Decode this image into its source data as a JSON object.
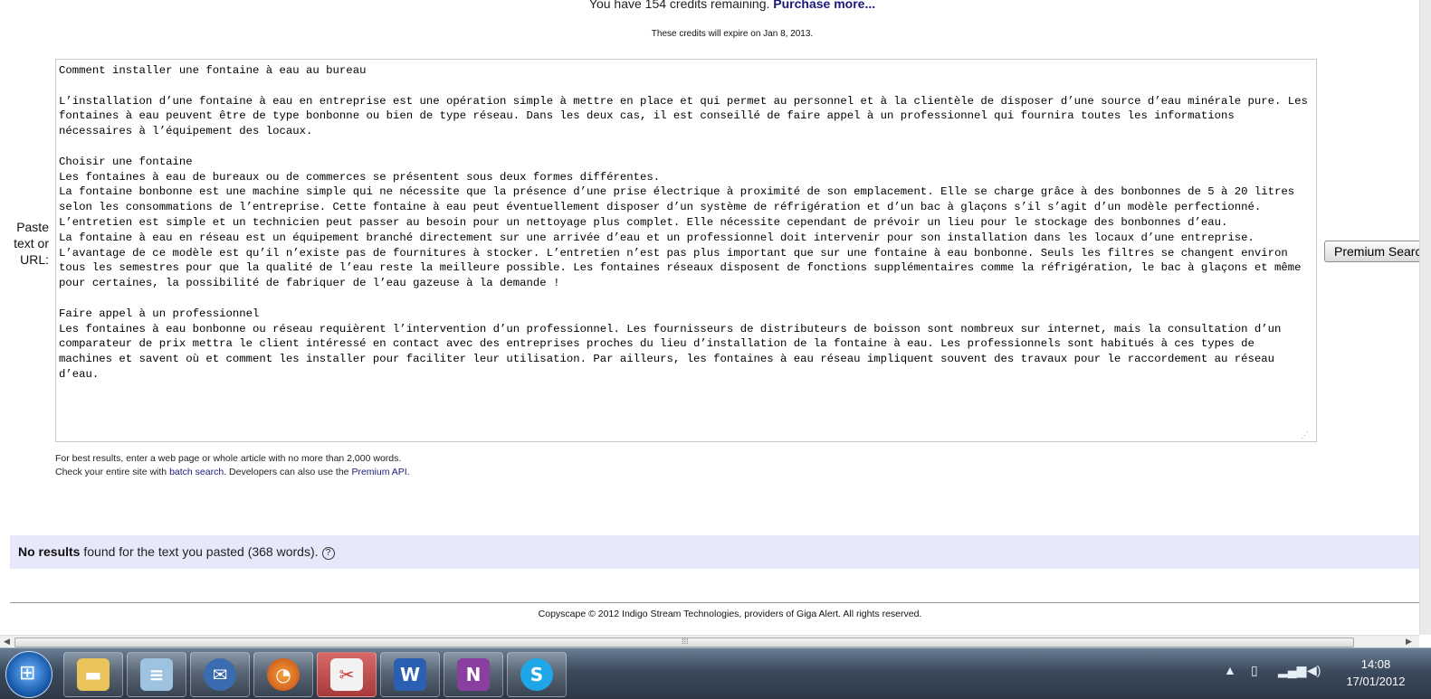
{
  "header": {
    "credits_text": "You have 154 credits remaining.",
    "purchase_link": "Purchase more...",
    "expire_text": "These credits will expire on Jan 8, 2013."
  },
  "form": {
    "paste_label": "Paste text or URL:",
    "text_value": "Comment installer une fontaine à eau au bureau\n\nL’installation d’une fontaine à eau en entreprise est une opération simple à mettre en place et qui permet au personnel et à la clientèle de disposer d’une source d’eau minérale pure. Les fontaines à eau peuvent être de type bonbonne ou bien de type réseau. Dans les deux cas, il est conseillé de faire appel à un professionnel qui fournira toutes les informations nécessaires à l’équipement des locaux.\n\nChoisir une fontaine\nLes fontaines à eau de bureaux ou de commerces se présentent sous deux formes différentes.\nLa fontaine bonbonne est une machine simple qui ne nécessite que la présence d’une prise électrique à proximité de son emplacement. Elle se charge grâce à des bonbonnes de 5 à 20 litres selon les consommations de l’entreprise. Cette fontaine à eau peut éventuellement disposer d’un système de réfrigération et d’un bac à glaçons s’il s’agit d’un modèle perfectionné. L’entretien est simple et un technicien peut passer au besoin pour un nettoyage plus complet. Elle nécessite cependant de prévoir un lieu pour le stockage des bonbonnes d’eau.\nLa fontaine à eau en réseau est un équipement branché directement sur une arrivée d’eau et un professionnel doit intervenir pour son installation dans les locaux d’une entreprise. L’avantage de ce modèle est qu’il n’existe pas de fournitures à stocker. L’entretien n’est pas plus important que sur une fontaine à eau bonbonne. Seuls les filtres se changent environ tous les semestres pour que la qualité de l’eau reste la meilleure possible. Les fontaines réseaux disposent de fonctions supplémentaires comme la réfrigération, le bac à glaçons et même pour certaines, la possibilité de fabriquer de l’eau gazeuse à la demande !\n\nFaire appel à un professionnel\nLes fontaines à eau bonbonne ou réseau requièrent l’intervention d’un professionnel. Les fournisseurs de distributeurs de boisson sont nombreux sur internet, mais la consultation d’un comparateur de prix mettra le client intéressé en contact avec des entreprises proches du lieu d’installation de la fontaine à eau. Les professionnels sont habitués à ces types de machines et savent où et comment les installer pour faciliter leur utilisation. Par ailleurs, les fontaines à eau réseau impliquent souvent des travaux pour le raccordement au réseau d’eau.",
    "search_button": "Premium Search",
    "hint_line1": "For best results, enter a web page or whole article with no more than 2,000 words.",
    "hint_line2_a": "Check your entire site with ",
    "batch_link": "batch search",
    "hint_line2_b": ". Developers can also use the ",
    "api_link": "Premium API",
    "hint_line2_c": "."
  },
  "results": {
    "bold": "No results",
    "text": " found for the text you pasted (368 words).",
    "help_icon": "?"
  },
  "footer": {
    "text": "Copyscape © 2012 Indigo Stream Technologies, providers of Giga Alert. All rights reserved."
  },
  "taskbar": {
    "apps": [
      "windows-explorer",
      "notepad",
      "thunderbird",
      "firefox",
      "snipping-tool",
      "word",
      "onenote",
      "skype"
    ],
    "time": "14:08",
    "date": "17/01/2012"
  }
}
